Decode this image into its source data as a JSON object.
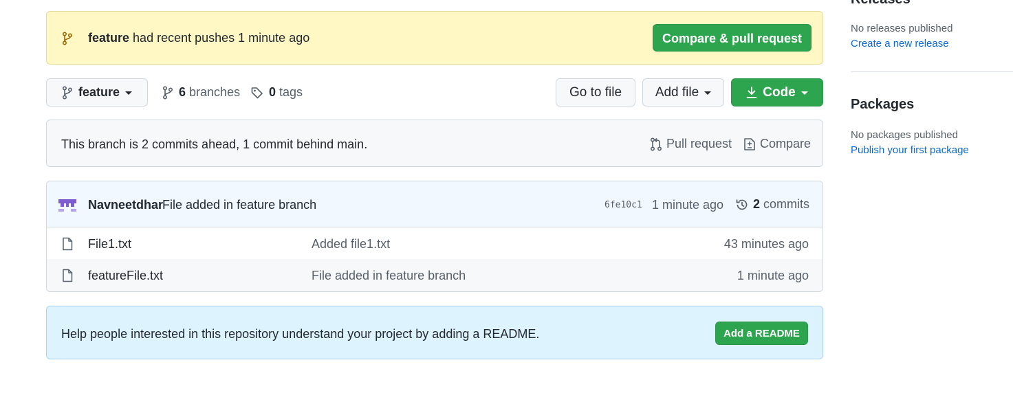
{
  "flash": {
    "branch": "feature",
    "message": "had recent pushes 1 minute ago",
    "button": "Compare & pull request"
  },
  "toolbar": {
    "branch_button": "feature",
    "branches_count": "6",
    "branches_label": "branches",
    "tags_count": "0",
    "tags_label": "tags",
    "go_to_file": "Go to file",
    "add_file": "Add file",
    "code": "Code"
  },
  "ahead_behind": {
    "text": "This branch is 2 commits ahead, 1 commit behind main.",
    "pull_request": "Pull request",
    "compare": "Compare"
  },
  "latest_commit": {
    "author": "Navneetdhar",
    "message": "File added in feature branch",
    "sha": "6fe10c1",
    "time": "1 minute ago",
    "commits_count": "2",
    "commits_label": "commits"
  },
  "files": [
    {
      "name": "File1.txt",
      "message": "Added file1.txt",
      "age": "43 minutes ago"
    },
    {
      "name": "featureFile.txt",
      "message": "File added in feature branch",
      "age": "1 minute ago"
    }
  ],
  "readme_prompt": {
    "text": "Help people interested in this repository understand your project by adding a README.",
    "button": "Add a README"
  },
  "sidebar": {
    "releases_heading": "Releases",
    "no_releases": "No releases published",
    "create_release": "Create a new release",
    "packages_heading": "Packages",
    "no_packages": "No packages published",
    "publish_package": "Publish your first package"
  },
  "colors": {
    "green": "#2da44e",
    "link_blue": "#0969da",
    "flash_yellow": "#fff8c5",
    "readme_blue": "#ddf4ff",
    "avatar_purple": "#7c5ccf"
  }
}
